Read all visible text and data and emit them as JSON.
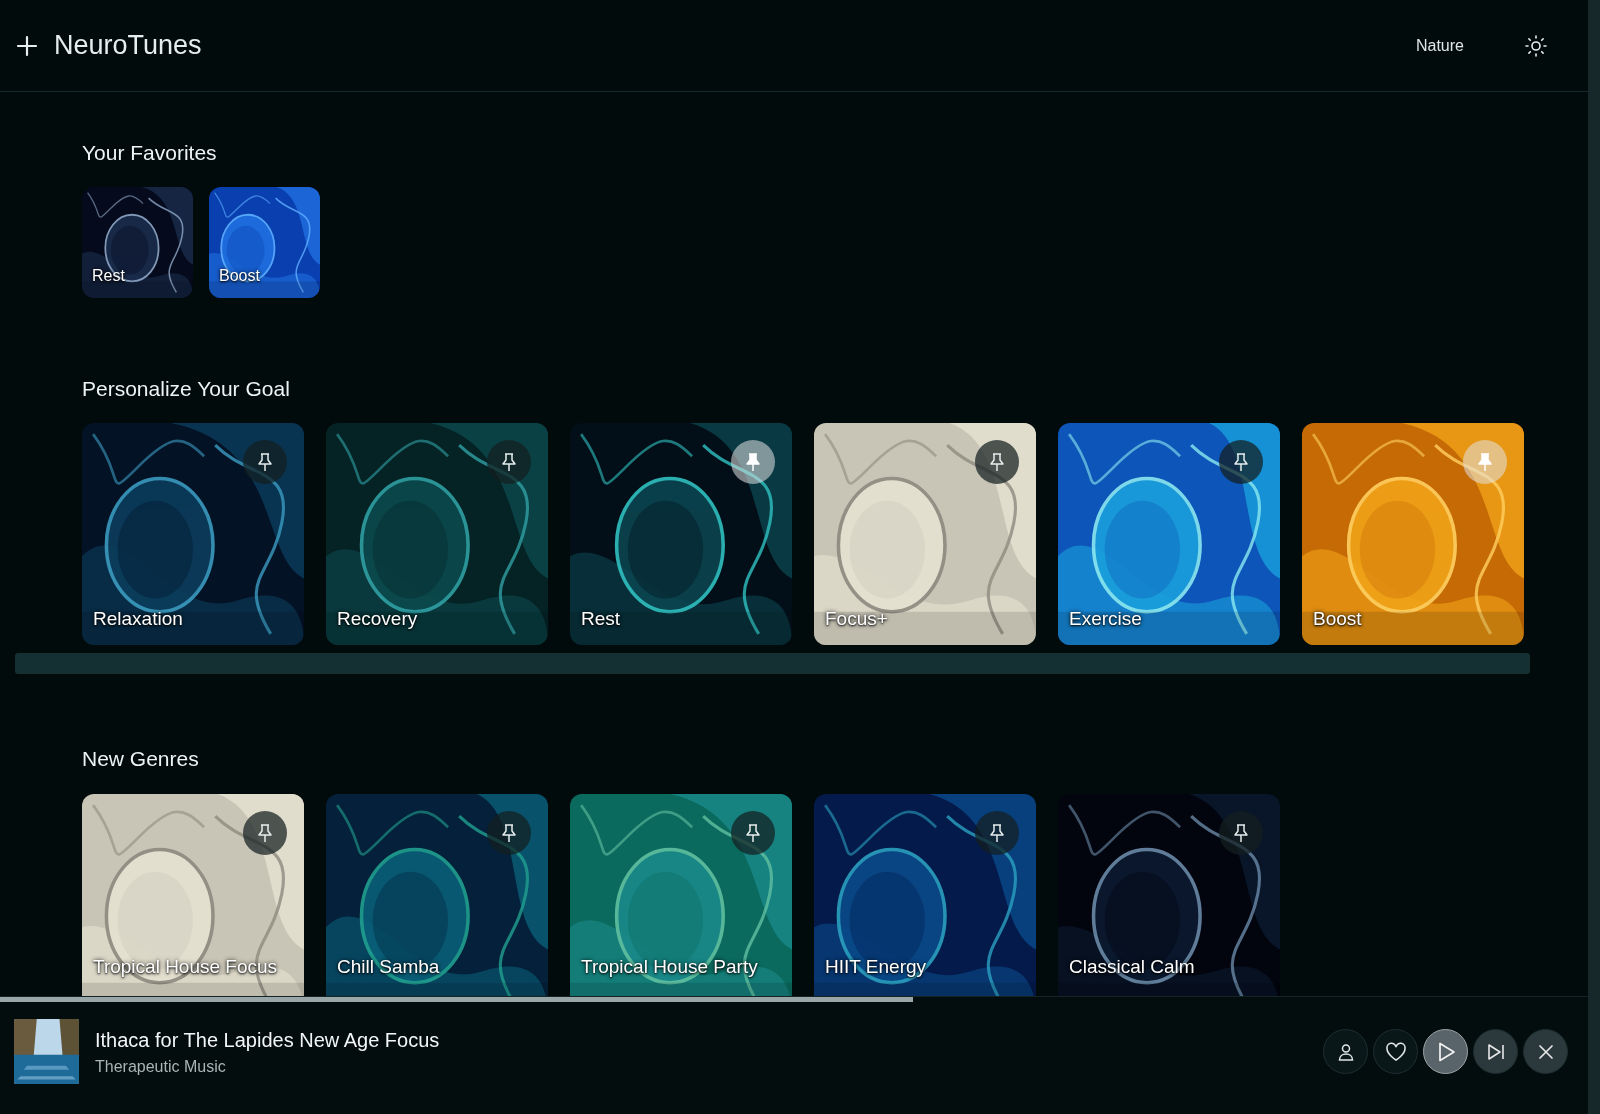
{
  "header": {
    "logo_text": "NeuroTunes",
    "nav_link": "Nature"
  },
  "favorites": {
    "title": "Your Favorites",
    "items": [
      {
        "label": "Rest",
        "kind": "picture"
      },
      {
        "label": "Boost",
        "kind": "picture"
      }
    ]
  },
  "goals": {
    "title": "Personalize Your Goal",
    "items": [
      {
        "label": "Relaxation",
        "pinned": false,
        "kind": "picture"
      },
      {
        "label": "Recovery",
        "pinned": false,
        "kind": "picture"
      },
      {
        "label": "Rest",
        "pinned": true,
        "kind": "picture"
      },
      {
        "label": "Focus+",
        "pinned": false,
        "kind": "picture"
      },
      {
        "label": "Exercise",
        "pinned": false,
        "kind": "picture"
      },
      {
        "label": "Boost",
        "pinned": true,
        "kind": "picture"
      }
    ]
  },
  "genres": {
    "title": "New Genres",
    "items": [
      {
        "label": "Tropical House Focus",
        "pinned": false,
        "kind": "picture"
      },
      {
        "label": "Chill Samba",
        "pinned": false,
        "kind": "picture"
      },
      {
        "label": "Tropical House Party",
        "pinned": false,
        "kind": "picture"
      },
      {
        "label": "HIIT Energy",
        "pinned": false,
        "kind": "picture"
      },
      {
        "label": "Classical Calm",
        "pinned": false,
        "kind": "picture"
      }
    ]
  },
  "player": {
    "title": "Ithaca for The Lapides New Age Focus",
    "subtitle": "Therapeutic Music",
    "level": 0.575
  }
}
